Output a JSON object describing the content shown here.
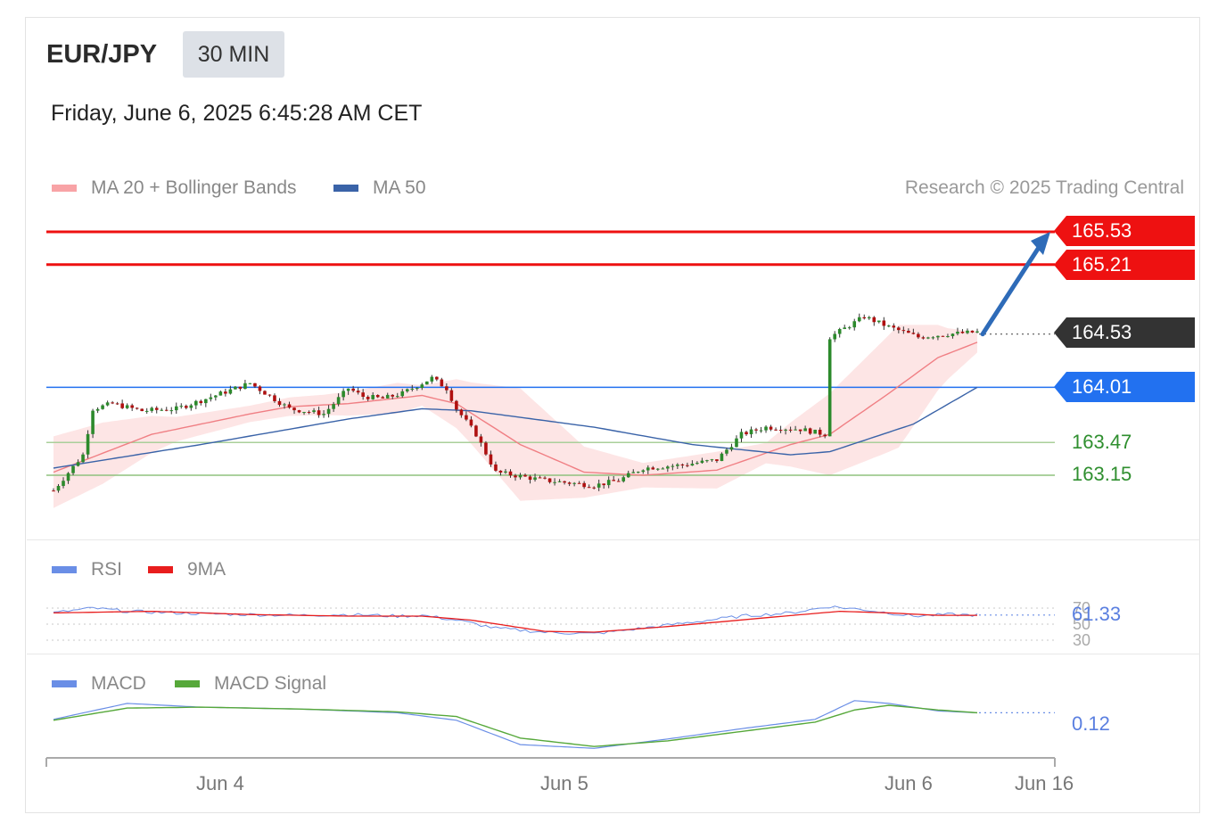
{
  "header": {
    "symbol": "EUR/JPY",
    "timeframe": "30 MIN",
    "datetime": "Friday, June 6, 2025 6:45:28 AM CET"
  },
  "legend": {
    "ma20_label": "MA 20 + Bollinger Bands",
    "ma50_label": "MA 50",
    "credit": "Research © 2025 Trading Central"
  },
  "colors": {
    "ma20": "#f07f84",
    "band": "#fde0e0",
    "ma50": "#3a63a8",
    "resistance": "#ee1111",
    "current": "#333333",
    "pivot": "#2271f0",
    "support": "#3d9b3d",
    "rsi": "#6a8ee6",
    "rsi_ma": "#e81d1d",
    "macd": "#6a8ee6",
    "macd_signal": "#56a83a",
    "candle_up": "#2c8a2c",
    "candle_down": "#b01010",
    "arrow": "#2e6bb8"
  },
  "levels": {
    "r1": "165.53",
    "r2": "165.21",
    "last": "164.53",
    "pivot": "164.01",
    "s1": "163.47",
    "s2": "163.15"
  },
  "rsi": {
    "label": "RSI",
    "ma_label": "9MA",
    "value": "61.33",
    "ticks": [
      "70",
      "50",
      "30"
    ]
  },
  "macd": {
    "label": "MACD",
    "signal_label": "MACD Signal",
    "value": "0.12"
  },
  "x_axis": {
    "labels": [
      "Jun 4",
      "Jun 5",
      "Jun 6",
      "Jun 16"
    ]
  },
  "chart_data": {
    "type": "candlestick",
    "x_labels": [
      "Jun 4",
      "Jun 5",
      "Jun 6",
      "Jun 16"
    ],
    "price_key_points": [
      [
        0,
        163.0
      ],
      [
        6,
        163.35
      ],
      [
        8,
        163.8
      ],
      [
        12,
        163.85
      ],
      [
        18,
        163.78
      ],
      [
        25,
        163.8
      ],
      [
        30,
        163.88
      ],
      [
        40,
        164.05
      ],
      [
        48,
        163.8
      ],
      [
        55,
        163.75
      ],
      [
        60,
        164.0
      ],
      [
        63,
        163.92
      ],
      [
        67,
        163.9
      ],
      [
        71,
        163.95
      ],
      [
        77,
        164.1
      ],
      [
        80,
        164.0
      ],
      [
        82,
        163.8
      ],
      [
        86,
        163.55
      ],
      [
        90,
        163.18
      ],
      [
        100,
        163.1
      ],
      [
        110,
        163.05
      ],
      [
        115,
        163.1
      ],
      [
        120,
        163.22
      ],
      [
        128,
        163.25
      ],
      [
        135,
        163.3
      ],
      [
        140,
        163.55
      ],
      [
        145,
        163.62
      ],
      [
        152,
        163.6
      ],
      [
        157,
        163.55
      ],
      [
        158,
        164.5
      ],
      [
        165,
        164.7
      ],
      [
        170,
        164.6
      ],
      [
        176,
        164.5
      ],
      [
        182,
        164.53
      ],
      [
        188,
        164.55
      ]
    ],
    "ma20_key_points": [
      [
        0,
        163.18
      ],
      [
        20,
        163.55
      ],
      [
        40,
        163.75
      ],
      [
        48,
        163.82
      ],
      [
        60,
        163.85
      ],
      [
        75,
        163.93
      ],
      [
        82,
        163.85
      ],
      [
        95,
        163.45
      ],
      [
        108,
        163.18
      ],
      [
        120,
        163.15
      ],
      [
        135,
        163.2
      ],
      [
        150,
        163.45
      ],
      [
        158,
        163.55
      ],
      [
        170,
        163.95
      ],
      [
        180,
        164.3
      ],
      [
        188,
        164.45
      ]
    ],
    "ma50_key_points": [
      [
        0,
        163.22
      ],
      [
        30,
        163.45
      ],
      [
        60,
        163.7
      ],
      [
        75,
        163.8
      ],
      [
        85,
        163.78
      ],
      [
        110,
        163.62
      ],
      [
        130,
        163.45
      ],
      [
        150,
        163.35
      ],
      [
        158,
        163.38
      ],
      [
        175,
        163.65
      ],
      [
        188,
        164.01
      ]
    ],
    "band_width_key_points": [
      [
        0,
        0.35
      ],
      [
        10,
        0.3
      ],
      [
        25,
        0.12
      ],
      [
        40,
        0.08
      ],
      [
        55,
        0.1
      ],
      [
        70,
        0.15
      ],
      [
        75,
        0.1
      ],
      [
        85,
        0.3
      ],
      [
        95,
        0.55
      ],
      [
        108,
        0.25
      ],
      [
        120,
        0.12
      ],
      [
        135,
        0.18
      ],
      [
        145,
        0.1
      ],
      [
        158,
        0.4
      ],
      [
        172,
        0.6
      ],
      [
        182,
        0.25
      ],
      [
        188,
        0.1
      ]
    ],
    "rsi_key_points": [
      [
        0,
        64
      ],
      [
        8,
        70
      ],
      [
        15,
        66
      ],
      [
        30,
        63
      ],
      [
        40,
        62
      ],
      [
        50,
        61
      ],
      [
        60,
        62
      ],
      [
        70,
        60
      ],
      [
        75,
        61
      ],
      [
        82,
        55
      ],
      [
        90,
        45
      ],
      [
        100,
        40
      ],
      [
        110,
        38
      ],
      [
        120,
        45
      ],
      [
        140,
        60
      ],
      [
        150,
        64
      ],
      [
        158,
        72
      ],
      [
        165,
        68
      ],
      [
        175,
        60
      ],
      [
        182,
        62
      ],
      [
        188,
        61.33
      ]
    ],
    "rsi_ma_key_points": [
      [
        0,
        64
      ],
      [
        20,
        66
      ],
      [
        40,
        62
      ],
      [
        60,
        60
      ],
      [
        75,
        60
      ],
      [
        85,
        55
      ],
      [
        100,
        41
      ],
      [
        110,
        40
      ],
      [
        125,
        47
      ],
      [
        145,
        58
      ],
      [
        160,
        66
      ],
      [
        170,
        64
      ],
      [
        180,
        61
      ],
      [
        188,
        61
      ]
    ],
    "macd_key_points": [
      [
        0,
        0.05
      ],
      [
        15,
        0.22
      ],
      [
        30,
        0.18
      ],
      [
        50,
        0.16
      ],
      [
        70,
        0.12
      ],
      [
        82,
        0.04
      ],
      [
        95,
        -0.22
      ],
      [
        110,
        -0.26
      ],
      [
        125,
        -0.16
      ],
      [
        140,
        -0.05
      ],
      [
        155,
        0.05
      ],
      [
        163,
        0.25
      ],
      [
        170,
        0.22
      ],
      [
        180,
        0.14
      ],
      [
        188,
        0.12
      ]
    ],
    "macd_signal_key_points": [
      [
        0,
        0.04
      ],
      [
        15,
        0.17
      ],
      [
        30,
        0.18
      ],
      [
        50,
        0.16
      ],
      [
        70,
        0.13
      ],
      [
        82,
        0.08
      ],
      [
        95,
        -0.15
      ],
      [
        110,
        -0.24
      ],
      [
        125,
        -0.18
      ],
      [
        140,
        -0.08
      ],
      [
        155,
        0.02
      ],
      [
        163,
        0.15
      ],
      [
        170,
        0.2
      ],
      [
        180,
        0.15
      ],
      [
        188,
        0.12
      ]
    ],
    "price_range": [
      163.0,
      165.6
    ],
    "rsi_range": [
      30,
      70
    ],
    "macd_range": [
      -0.3,
      0.3
    ],
    "n_bars": 189,
    "grid": false,
    "legend": "top-left",
    "forecast_target": 165.53
  }
}
